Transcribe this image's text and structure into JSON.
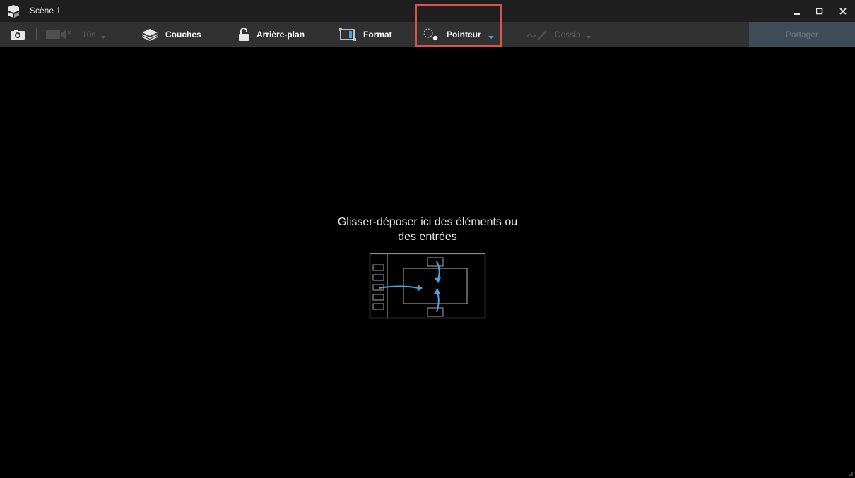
{
  "window": {
    "title": "Scène 1"
  },
  "toolbar": {
    "timer_label": "10s",
    "layers_label": "Couches",
    "background_label": "Arrière-plan",
    "format_label": "Format",
    "pointer_label": "Pointeur",
    "draw_label": "Dessin",
    "share_label": "Partager"
  },
  "canvas": {
    "drop_hint_line1": "Glisser-déposer ici des éléments ou",
    "drop_hint_line2": "des entrées"
  },
  "colors": {
    "titlebar_bg": "#1f1f1f",
    "toolbar_bg": "#313131",
    "canvas_bg": "#000000",
    "accent_blue": "#4aa3d8",
    "highlight_red": "#d9534f",
    "share_bg": "#3f4c55"
  },
  "icons": {
    "app": "app-logo-icon",
    "minimize": "minimize-icon",
    "maximize": "maximize-icon",
    "close": "close-icon",
    "snapshot": "camera-icon",
    "record": "video-camera-icon",
    "layers": "layers-icon",
    "background": "lock-icon",
    "format": "aspect-ratio-icon",
    "pointer": "pointer-icon",
    "draw": "pen-icon"
  }
}
